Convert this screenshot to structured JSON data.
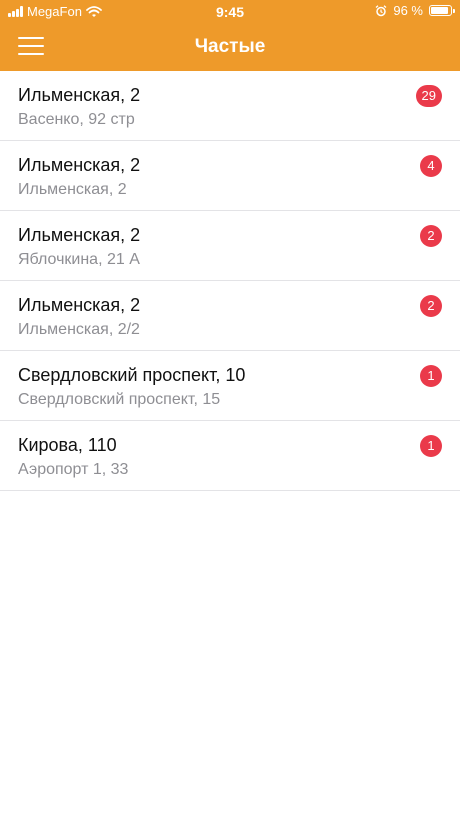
{
  "status_bar": {
    "carrier": "MegaFon",
    "time": "9:45",
    "battery": "96 %",
    "battery_level": 0.96,
    "icons": [
      "signal-icon",
      "wifi-icon",
      "alarm-icon",
      "battery-icon"
    ]
  },
  "header": {
    "title": "Частые",
    "menu_icon": "hamburger-menu-icon",
    "color": "#ee9a2a"
  },
  "colors": {
    "badge": "#ea3a4a",
    "divider": "#e3e3e6",
    "subtitle": "#8e8e93"
  },
  "list": {
    "items": [
      {
        "title": "Ильменская, 2",
        "subtitle": "Васенко, 92 стр",
        "count": "29"
      },
      {
        "title": "Ильменская, 2",
        "subtitle": "Ильменская, 2",
        "count": "4"
      },
      {
        "title": "Ильменская, 2",
        "subtitle": "Яблочкина, 21 А",
        "count": "2"
      },
      {
        "title": "Ильменская, 2",
        "subtitle": "Ильменская, 2/2",
        "count": "2"
      },
      {
        "title": "Свердловский проспект, 10",
        "subtitle": "Свердловский проспект, 15",
        "count": "1"
      },
      {
        "title": "Кирова, 110",
        "subtitle": "Аэропорт 1, 33",
        "count": "1"
      }
    ]
  }
}
